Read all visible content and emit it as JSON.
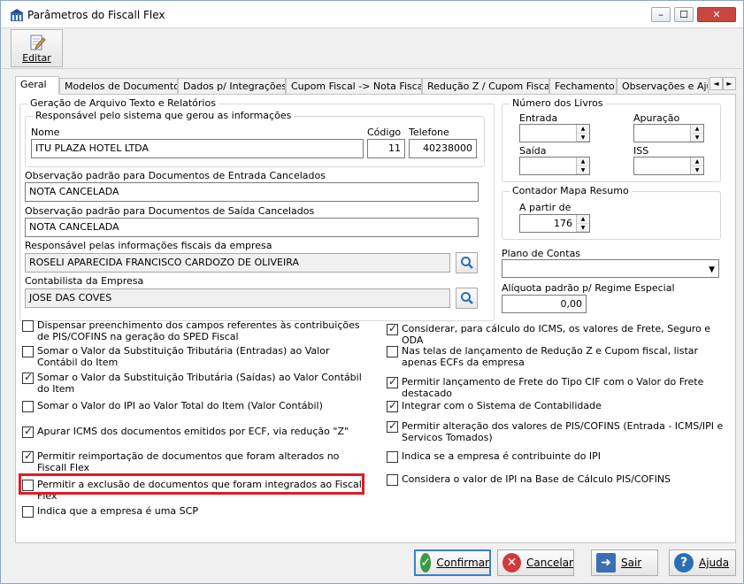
{
  "window": {
    "title": "Parâmetros do Fiscall Flex",
    "min": "–",
    "max": "☐",
    "close": "✕"
  },
  "toolbar": {
    "edit_label": "Editar"
  },
  "tabs": [
    "Geral",
    "Modelos de Documento",
    "Dados p/ Integrações",
    "Cupom Fiscal -> Nota Fiscal",
    "Redução Z / Cupom Fiscal",
    "Fechamento",
    "Observações e Ajus"
  ],
  "tab_scroll": {
    "left": "◄",
    "right": "►"
  },
  "geracao": {
    "title": "Geração de Arquivo Texto e Relatórios",
    "responsavel": {
      "title": "Responsável pelo sistema que gerou as informações",
      "nome_label": "Nome",
      "nome": "ITU PLAZA HOTEL LTDA",
      "codigo_label": "Código",
      "codigo": "11",
      "telefone_label": "Telefone",
      "telefone": "40238000"
    },
    "obs_entrada_label": "Observação padrão para Documentos de Entrada Cancelados",
    "obs_entrada": "NOTA CANCELADA",
    "obs_saida_label": "Observação padrão para Documentos de Saída Cancelados",
    "obs_saida": "NOTA CANCELADA",
    "resp_fiscal_label": "Responsável pelas informações fiscais da empresa",
    "resp_fiscal": "ROSELI APARECIDA FRANCISCO CARDOZO DE OLIVEIRA",
    "contabilista_label": "Contabilista da Empresa",
    "contabilista": "JOSE DAS COVES"
  },
  "livros": {
    "title": "Número dos Livros",
    "entrada_label": "Entrada",
    "apuracao_label": "Apuração",
    "saida_label": "Saída",
    "iss_label": "ISS",
    "entrada": "",
    "apuracao": "",
    "saida": "",
    "iss": ""
  },
  "contador": {
    "title": "Contador Mapa Resumo",
    "a_partir_label": "A partir de",
    "a_partir": "176"
  },
  "plano_contas_label": "Plano de Contas",
  "plano_contas": "",
  "aliquota_label": "Alíquota padrão p/ Regime Especial",
  "aliquota": "0,00",
  "checks_left": [
    {
      "label": "Dispensar preenchimento dos campos referentes às contribuições de PIS/COFINS na geração do SPED Fiscal",
      "checked": false
    },
    {
      "label": "Somar o Valor da Substituição Tributária (Entradas) ao Valor Contábil do Item",
      "checked": false
    },
    {
      "label": "Somar o Valor da Substituição Tributária (Saídas) ao Valor Contábil do Item",
      "checked": true
    },
    {
      "label": "Somar o Valor do IPI ao Valor Total do Item (Valor Contábil)",
      "checked": false
    },
    {
      "label": "Apurar ICMS dos documentos emitidos por ECF, via redução \"Z\"",
      "checked": true
    },
    {
      "label": "Permitir reimportação de documentos que foram alterados no Fiscall Flex",
      "checked": true
    },
    {
      "label": "Permitir a exclusão de documentos que foram integrados ao Fiscall Flex",
      "checked": false
    },
    {
      "label": "Indica que a empresa é uma SCP",
      "checked": false
    }
  ],
  "checks_right": [
    {
      "label": "Considerar, para cálculo do ICMS, os valores de Frete, Seguro e ODA",
      "checked": true
    },
    {
      "label": "Nas telas de lançamento de Redução Z e Cupom fiscal, listar apenas ECFs da empresa",
      "checked": false
    },
    {
      "label": "Permitir lançamento de Frete do Tipo CIF com o Valor do Frete destacado",
      "checked": true
    },
    {
      "label": "Integrar com o Sistema de Contabilidade",
      "checked": true
    },
    {
      "label": "Permitir alteração dos valores de PIS/COFINS (Entrada - ICMS/IPI e Servicos Tomados)",
      "checked": true
    },
    {
      "label": "Indica se a empresa é contribuinte do IPI",
      "checked": false
    },
    {
      "label": "Considera o valor de IPI na Base de Cálculo PIS/COFINS",
      "checked": false
    }
  ],
  "buttons": {
    "confirmar": "Confirmar",
    "cancelar": "Cancelar",
    "sair": "Sair",
    "ajuda": "Ajuda"
  }
}
